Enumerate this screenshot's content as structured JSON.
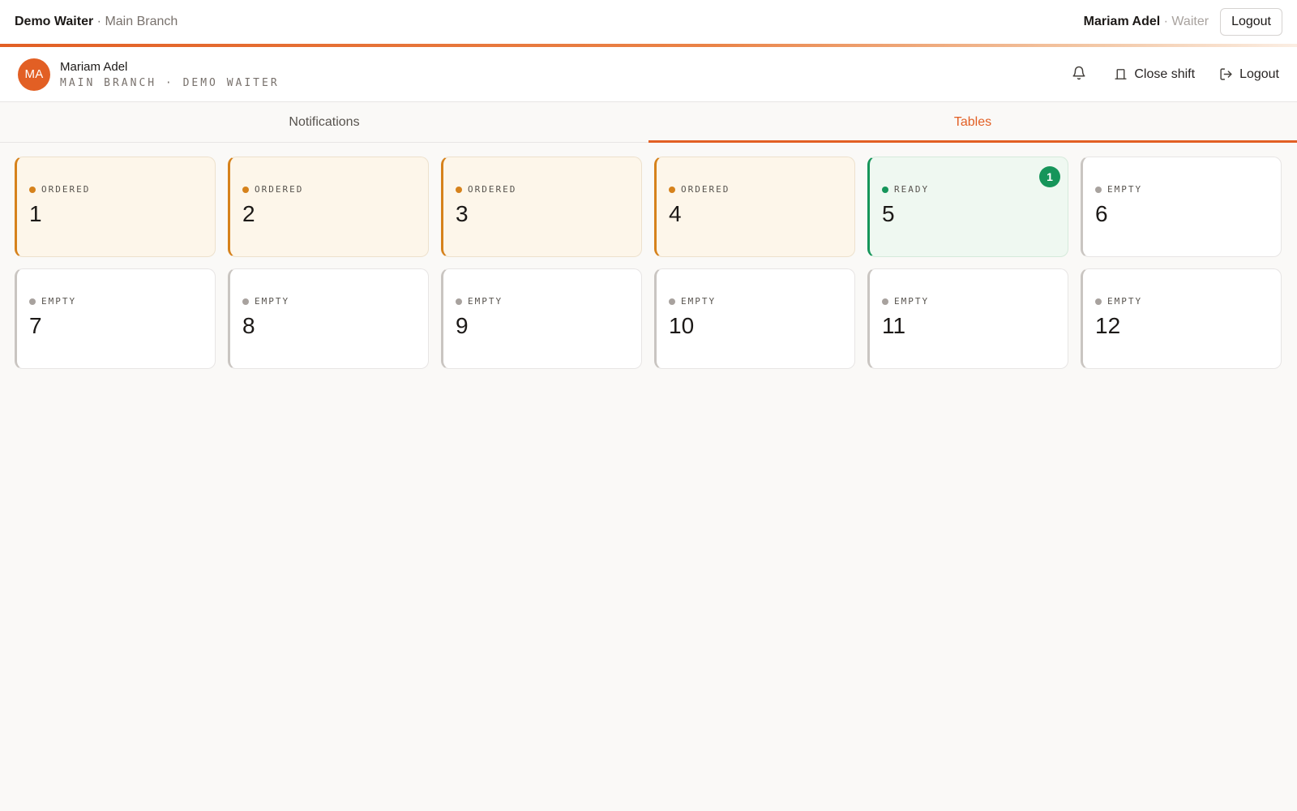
{
  "topbar": {
    "app_name": "Demo Waiter",
    "separator": "·",
    "branch": "Main Branch",
    "user_name": "Mariam Adel",
    "role": "Waiter",
    "logout_label": "Logout"
  },
  "colors": {
    "accent": "#e25f24",
    "ordered": "#d6821c",
    "ready": "#16955a",
    "empty": "#a8a29e"
  },
  "profile": {
    "initials": "MA",
    "name": "Mariam Adel",
    "subtitle": "MAIN BRANCH · DEMO WAITER",
    "bell_icon": "bell-icon",
    "close_shift_label": "Close shift",
    "close_shift_icon": "register-icon",
    "logout_label": "Logout",
    "logout_icon": "logout-icon"
  },
  "tabs": [
    {
      "label": "Notifications",
      "active": false
    },
    {
      "label": "Tables",
      "active": true
    }
  ],
  "tables": [
    {
      "number": "1",
      "status": "ORDERED",
      "state": "ordered",
      "badge": null
    },
    {
      "number": "2",
      "status": "ORDERED",
      "state": "ordered",
      "badge": null
    },
    {
      "number": "3",
      "status": "ORDERED",
      "state": "ordered",
      "badge": null
    },
    {
      "number": "4",
      "status": "ORDERED",
      "state": "ordered",
      "badge": null
    },
    {
      "number": "5",
      "status": "READY",
      "state": "ready",
      "badge": "1"
    },
    {
      "number": "6",
      "status": "EMPTY",
      "state": "empty",
      "badge": null
    },
    {
      "number": "7",
      "status": "EMPTY",
      "state": "empty",
      "badge": null
    },
    {
      "number": "8",
      "status": "EMPTY",
      "state": "empty",
      "badge": null
    },
    {
      "number": "9",
      "status": "EMPTY",
      "state": "empty",
      "badge": null
    },
    {
      "number": "10",
      "status": "EMPTY",
      "state": "empty",
      "badge": null
    },
    {
      "number": "11",
      "status": "EMPTY",
      "state": "empty",
      "badge": null
    },
    {
      "number": "12",
      "status": "EMPTY",
      "state": "empty",
      "badge": null
    }
  ]
}
